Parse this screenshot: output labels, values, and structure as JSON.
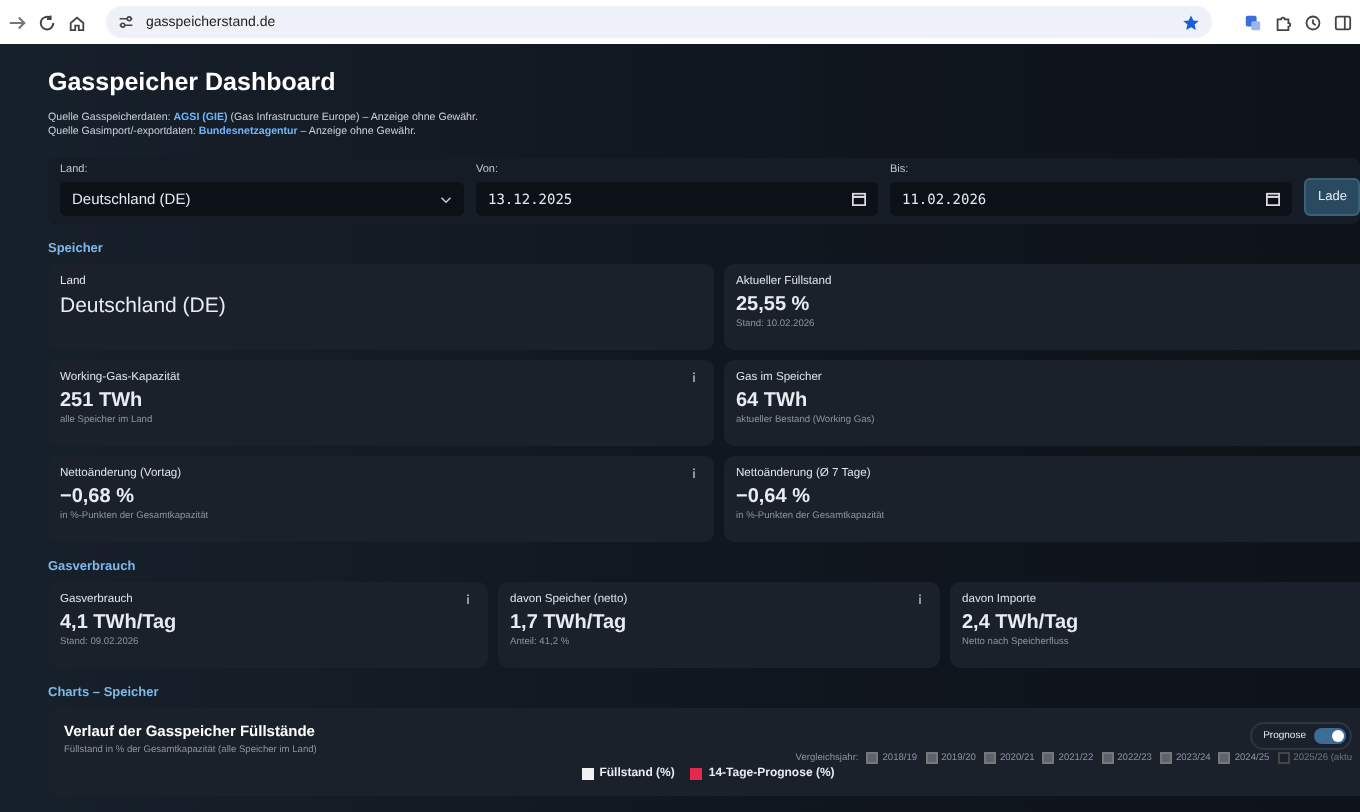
{
  "browser": {
    "url": "gasspeicherstand.de"
  },
  "header": {
    "title": "Gasspeicher Dashboard",
    "sources": [
      {
        "text": "Quelle Gasspeicherdaten:",
        "link": "AGSI (GIE)",
        "after": "(Gas Infrastructure Europe) – Anzeige ohne Gewähr."
      },
      {
        "text": "Quelle Gasimport/-exportdaten:",
        "link": "Bundesnetzagentur",
        "after": "– Anzeige ohne Gewähr."
      }
    ]
  },
  "filters": {
    "country": {
      "label": "Land:",
      "value": "Deutschland (DE)"
    },
    "from": {
      "label": "Von:",
      "value": "13.12.2025"
    },
    "to": {
      "label": "Bis:",
      "value": "11.02.2026"
    },
    "button": "Lade"
  },
  "sections": [
    {
      "title": "Speicher",
      "cards": [
        {
          "label": "Land",
          "value": "Deutschland (DE)",
          "info": false
        },
        {
          "label": "Aktueller Füllstand",
          "value": "25,55 %",
          "note": "Stand: 10.02.2026",
          "info": false
        },
        {
          "label": "Working-Gas-Kapazität",
          "value": "251 TWh",
          "note": "alle Speicher im Land",
          "info": true
        },
        {
          "label": "Gas im Speicher",
          "value": "64 TWh",
          "note": "aktueller Bestand (Working Gas)",
          "info": false
        },
        {
          "label": "Nettoänderung (Vortag)",
          "value": "−0,68 %",
          "note": "in %-Punkten der Gesamtkapazität",
          "info": true
        },
        {
          "label": "Nettoänderung (Ø 7 Tage)",
          "value": "−0,64 %",
          "note": "in %-Punkten der Gesamtkapazität",
          "info": false
        }
      ]
    },
    {
      "title": "Gasverbrauch",
      "cards": [
        {
          "label": "Gasverbrauch",
          "value": "4,1 TWh/Tag",
          "note": "Stand: 09.02.2026",
          "info": true
        },
        {
          "label": "davon Speicher (netto)",
          "value": "1,7 TWh/Tag",
          "note": "Anteil: 41,2 %",
          "info": true
        },
        {
          "label": "davon Importe",
          "value": "2,4 TWh/Tag",
          "note": "Netto nach Speicherfluss",
          "info": false
        }
      ]
    }
  ],
  "charts": {
    "title": "Charts – Speicher",
    "card": {
      "title": "Verlauf der Gasspeicher Füllstände",
      "subtitle": "Füllstand in % der Gesamtkapazität (alle Speicher im Land)",
      "toggle": {
        "label": "Prognose",
        "on": true
      },
      "years_label": "Vergleichsjahr:",
      "years": [
        {
          "label": "2018/19",
          "checked": false,
          "disabled": false
        },
        {
          "label": "2019/20",
          "checked": false,
          "disabled": false
        },
        {
          "label": "2020/21",
          "checked": false,
          "disabled": false
        },
        {
          "label": "2021/22",
          "checked": false,
          "disabled": false
        },
        {
          "label": "2022/23",
          "checked": false,
          "disabled": false
        },
        {
          "label": "2023/24",
          "checked": false,
          "disabled": false
        },
        {
          "label": "2024/25",
          "checked": false,
          "disabled": false
        },
        {
          "label": "2025/26 (aktu",
          "checked": false,
          "disabled": true
        }
      ],
      "legend": [
        {
          "label": "Füllstand (%)",
          "color": "#f2f2f2"
        },
        {
          "label": "14-Tage-Prognose (%)",
          "color": "#e8294f"
        }
      ]
    }
  }
}
